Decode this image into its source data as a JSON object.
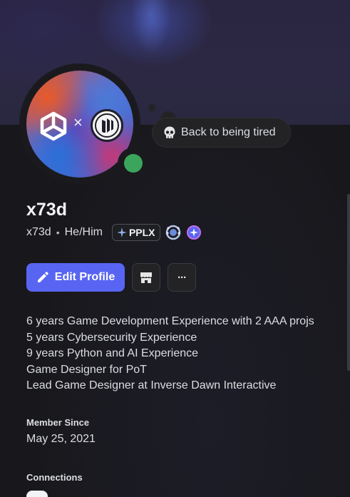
{
  "status": {
    "text": "Back to being tired",
    "icon": "skull-icon"
  },
  "user": {
    "display_name": "x73d",
    "username": "x73d",
    "pronouns": "He/Him",
    "separator": "•",
    "online_status_color": "#3ba55c"
  },
  "avatar": {
    "times_glyph": "×"
  },
  "clan": {
    "tag": "PPLX"
  },
  "actions": {
    "edit_profile_label": "Edit Profile",
    "more_glyph": "···"
  },
  "bio": {
    "lines": [
      "6 years Game Development Experience with 2 AAA projs",
      "5 years Cybersecurity Experience",
      "9 years Python and AI Experience",
      "Game Designer for PoT",
      "Lead Game Designer at Inverse Dawn Interactive"
    ]
  },
  "member_since": {
    "title": "Member Since",
    "date": "May 25, 2021"
  },
  "connections": {
    "title": "Connections"
  },
  "colors": {
    "accent": "#5865f2",
    "background": "#1a1a1e"
  }
}
